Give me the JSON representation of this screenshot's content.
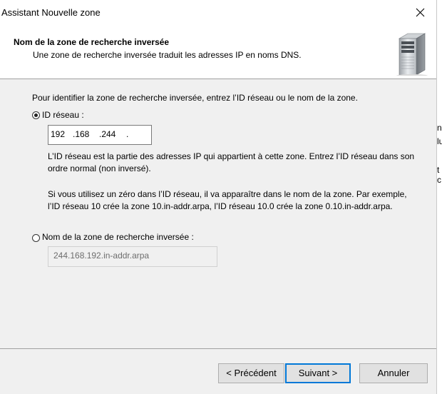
{
  "window": {
    "title": "Assistant Nouvelle zone"
  },
  "header": {
    "title": "Nom de la zone de recherche inversée",
    "subtitle": "Une zone de recherche inversée traduit les adresses IP en noms DNS."
  },
  "content": {
    "instruction": "Pour identifier la zone de recherche inversée, entrez l’ID réseau ou le nom de la zone.",
    "option_network_id": {
      "label": "ID réseau :",
      "selected": true
    },
    "network_id": {
      "octet1": "192",
      "octet2": ".168",
      "octet3": ".244",
      "octet4": "."
    },
    "para1": "L’ID réseau est la partie des adresses IP qui appartient à cette zone. Entrez l’ID réseau dans son ordre normal (non inversé).",
    "para2": "Si vous utilisez un zéro dans l’ID réseau, il va apparaître dans le nom de la zone. Par exemple, l’ID réseau 10 crée la zone 10.in-addr.arpa, l’ID réseau 10.0 crée la zone 0.10.in-addr.arpa.",
    "option_zone_name": {
      "label": "Nom de la zone de recherche inversée :",
      "selected": false
    },
    "zone_name_value": "244.168.192.in-addr.arpa"
  },
  "buttons": {
    "previous": "< Précédent",
    "next": "Suivant >",
    "cancel": "Annuler"
  },
  "background_window": {
    "fragments": [
      "n",
      "lu",
      "t c"
    ]
  },
  "colors": {
    "accent": "#0078d7",
    "button_face": "#e1e1e1",
    "dialog_bg": "#f0f0f0"
  }
}
